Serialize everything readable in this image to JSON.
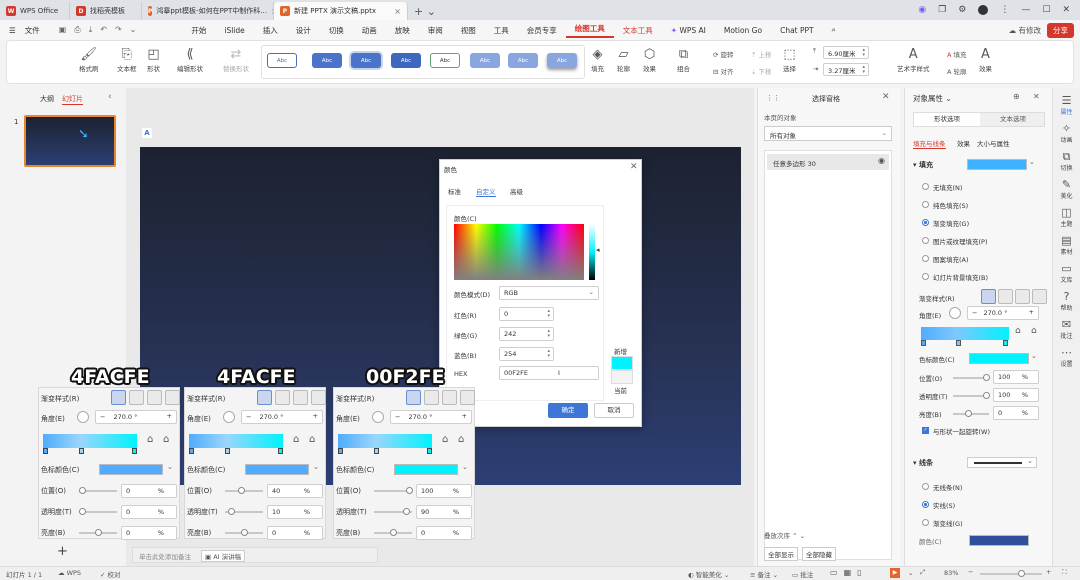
{
  "title_tabs": [
    {
      "label": "WPS Office",
      "badge": "W",
      "color": "#d4372b"
    },
    {
      "label": "找稻壳模板",
      "badge": "D",
      "color": "#d4372b"
    },
    {
      "label": "鸿搴ppt模板-如何在PPT中制作科...",
      "badge": "P",
      "color": "#e0652b"
    },
    {
      "label": "新建 PPTX 演示文稿.pptx",
      "badge": "P",
      "color": "#e0652b"
    }
  ],
  "menu": {
    "file": "文件",
    "items": [
      "开始",
      "iSlide",
      "插入",
      "设计",
      "切换",
      "动画",
      "放映",
      "审阅",
      "视图",
      "工具",
      "会员专享",
      "绘图工具",
      "文本工具",
      "WPS AI",
      "Motion Go",
      "Chat PPT"
    ],
    "right": [
      "有修改",
      "分享"
    ]
  },
  "ribbon": {
    "format_painter": "格式刷",
    "textbox": "文本框",
    "shape": "形状",
    "edit_shape": "编辑形状",
    "replace_shape": "替换形状",
    "abc": "Abc",
    "fill": "填充",
    "outline": "轮廓",
    "effect": "效果",
    "group": "组合",
    "rotate": "旋转",
    "align": "对齐",
    "move_up": "上移",
    "move_down": "下移",
    "select": "选择",
    "width": "6.90厘米",
    "height": "3.27厘米",
    "art_text": "艺术字样式",
    "text_fill": "填充",
    "text_outline": "轮廓",
    "text_effect": "效果"
  },
  "left": {
    "outline_tab": "大纲",
    "slides_tab": "幻灯片",
    "slide_number": "1"
  },
  "selection_pane": {
    "title": "选择窗格",
    "objects_on_page": "本页的对象",
    "filter": "所有对象",
    "item": "任意多边形 30",
    "order": "叠放次序",
    "show_all": "全部显示",
    "hide_all": "全部隐藏"
  },
  "props": {
    "title": "对象属性",
    "tab_shape": "形状选项",
    "tab_text": "文本选项",
    "sub_fill": "填充与线条",
    "sub_effect": "效果",
    "sub_size": "大小与属性",
    "fill_section": "填充",
    "options": [
      "无填充(N)",
      "纯色填充(S)",
      "渐变填充(G)",
      "图片或纹理填充(P)",
      "图案填充(A)",
      "幻灯片背景填充(B)"
    ],
    "gradient_style": "渐变样式(R)",
    "angle_label": "角度(E)",
    "angle": "270.0",
    "degree": "°",
    "stop_color": "色标颜色(C)",
    "position": "位置(O)",
    "position_value": "100",
    "transparency": "透明度(T)",
    "transparency_value": "100",
    "brightness": "亮度(B)",
    "brightness_value": "0",
    "pct": "%",
    "rotate_with_shape": "与形状一起旋转(W)",
    "line_section": "线条",
    "line_options": [
      "无线条(N)",
      "实线(S)",
      "渐变线(G)"
    ],
    "color_label": "颜色(C)"
  },
  "rail": [
    "属性",
    "动画",
    "切换",
    "美化",
    "主题",
    "素材",
    "文库",
    "帮助",
    "批注",
    "设置"
  ],
  "dialog": {
    "title": "颜色",
    "tabs": [
      "标准",
      "自定义",
      "高级"
    ],
    "colors_label": "颜色(C)",
    "mode_label": "颜色模式(D)",
    "mode": "RGB",
    "red_label": "红色(R)",
    "red": "0",
    "green_label": "绿色(G)",
    "green": "242",
    "blue_label": "蓝色(B)",
    "blue": "254",
    "hex_label": "HEX",
    "hex": "00F2FE",
    "new": "新增",
    "current": "当前",
    "ok": "确定",
    "cancel": "取消",
    "new_color": "#00f2fe"
  },
  "fill_panels": [
    {
      "caption": "4FACFE",
      "position": "0",
      "transparency": "0",
      "brightness": "0",
      "color": "#4facfe",
      "pos_frac": 0.0
    },
    {
      "caption": "4FACFE",
      "position": "40",
      "transparency": "10",
      "brightness": "0",
      "color": "#4facfe",
      "pos_frac": 0.4
    },
    {
      "caption": "00F2FE",
      "position": "100",
      "transparency": "90",
      "brightness": "0",
      "color": "#00f2fe",
      "pos_frac": 1.0
    }
  ],
  "canvas": {
    "note_placeholder": "单击此处添加备注",
    "ai_notes": "AI 演讲稿"
  },
  "status": {
    "slide": "幻灯片 1 / 1",
    "wps": "WPS",
    "proof": "校对",
    "smart": "智能美化",
    "notes": "备注",
    "comments": "批注",
    "zoom": "83%"
  },
  "colors": {
    "accent": "#d4372b",
    "blue": "#3c76d6"
  }
}
